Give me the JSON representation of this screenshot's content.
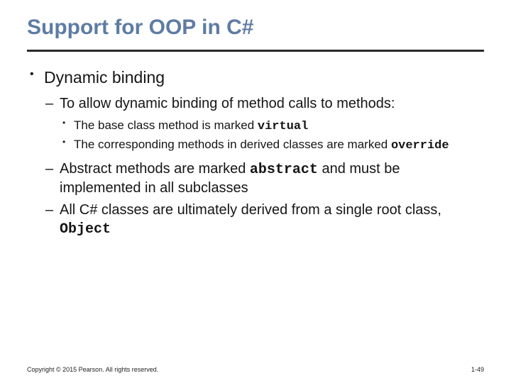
{
  "title": "Support for OOP in C#",
  "bullet1": "Dynamic binding",
  "sub1": "To allow dynamic binding of method calls to methods:",
  "sub1a_pre": "The base class method is marked ",
  "sub1a_code": "virtual",
  "sub1b_pre": "The corresponding methods in derived classes are marked ",
  "sub1b_code": "override",
  "sub2_pre": "Abstract methods are marked ",
  "sub2_code": "abstract",
  "sub2_post": " and must be implemented in all subclasses",
  "sub3_pre": "All C# classes are ultimately derived from a single root class, ",
  "sub3_code": "Object",
  "copyright": "Copyright © 2015 Pearson. All rights reserved.",
  "pagenum": "1-49"
}
